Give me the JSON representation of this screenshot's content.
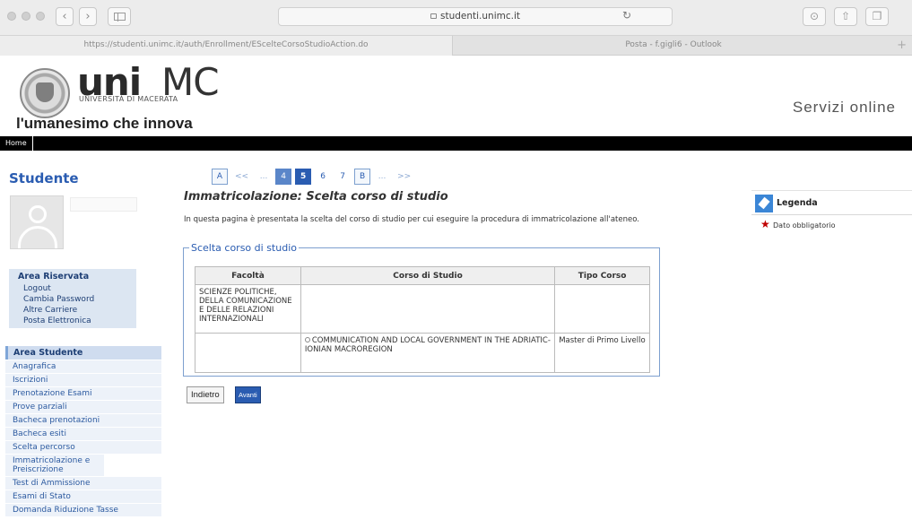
{
  "browser": {
    "address_url": "studenti.unimc.it",
    "tabs": [
      {
        "title": "https://studenti.unimc.it/auth/Enrollment/EScelteCorsoStudioAction.do"
      },
      {
        "title": "Posta - f.gigli6 - Outlook"
      }
    ],
    "new_tab_symbol": "+",
    "icons": [
      "back-icon",
      "forward-icon",
      "sidebar-icon",
      "lock-icon",
      "reload-icon",
      "download-icon",
      "share-icon",
      "tabs-icon"
    ]
  },
  "header": {
    "brand_uni": "uni",
    "brand_mc": "MC",
    "brand_subtitle": "UNIVERSITÀ DI MACERATA",
    "slogan": "l'umanesimo che innova",
    "services_label": "Servizi online",
    "topnav": {
      "home": "Home"
    }
  },
  "sidebar": {
    "title": "Studente",
    "reserved": {
      "header": "Area Riservata",
      "items": [
        "Logout",
        "Cambia Password",
        "Altre Carriere",
        "Posta Elettronica"
      ]
    },
    "student_area": {
      "header": "Area Studente",
      "items": [
        "Anagrafica",
        "Iscrizioni",
        "Prenotazione Esami",
        "Prove parziali",
        "Bacheca prenotazioni",
        "Bacheca esiti",
        "Scelta percorso",
        "Immatricolazione e Preiscrizione",
        "Test di Ammissione",
        "Esami di Stato",
        "Domanda Riduzione Tasse"
      ]
    }
  },
  "main": {
    "pager": [
      "A",
      "<<",
      "...",
      "4",
      "5",
      "6",
      "7",
      "B",
      "...",
      ">>"
    ],
    "title": "Immatricolazione: Scelta corso di studio",
    "intro": "In questa pagina è presentata la scelta del corso di studio per cui eseguire la procedura di immatricolazione all'ateneo.",
    "fieldset_legend": "Scelta corso di studio",
    "table": {
      "headers": [
        "Facoltà",
        "Corso di Studio",
        "Tipo Corso"
      ],
      "rows": [
        {
          "facolta": "SCIENZE POLITICHE, DELLA COMUNICAZIONE E DELLE RELAZIONI INTERNAZIONALI",
          "corso": "",
          "tipo": ""
        },
        {
          "facolta": "",
          "corso": "COMMUNICATION AND LOCAL GOVERNMENT IN THE ADRIATIC-IONIAN MACROREGION",
          "tipo": "Master di Primo Livello"
        }
      ]
    },
    "buttons": {
      "back": "Indietro",
      "next": "Avanti"
    }
  },
  "legend": {
    "title": "Legenda",
    "required_text": "Dato obbligatorio",
    "required_symbol": "★"
  },
  "colors": {
    "brand_blue": "#2a5cb1",
    "topbar": "#000000",
    "sidebar_bg": "#dce6f2",
    "required_red": "#c00000"
  }
}
